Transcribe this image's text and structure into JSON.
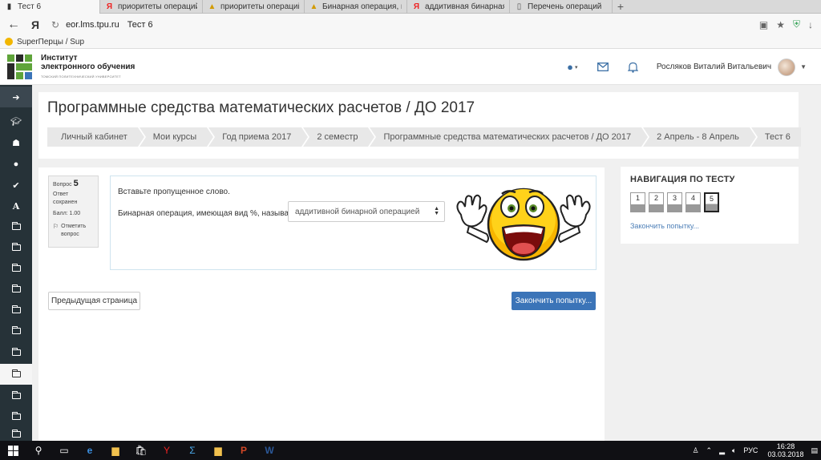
{
  "browser": {
    "tabs": [
      {
        "label": "Тест 6",
        "icon": "moodle-icon",
        "active": true
      },
      {
        "label": "приоритеты операций в вы",
        "icon": "yandex-icon",
        "active": false
      },
      {
        "label": "приоритеты операций в вы",
        "icon": "slides-icon",
        "active": false
      },
      {
        "label": "Бинарная операция, имею",
        "icon": "slides-icon",
        "active": false
      },
      {
        "label": "аддитивная бинарная опер",
        "icon": "yandex-icon",
        "active": false
      },
      {
        "label": "Перечень операций",
        "icon": "page-icon",
        "active": false
      }
    ],
    "url_domain": "eor.lms.tpu.ru",
    "url_title": "Тест 6",
    "bookmark": "SuperПерцы / Sup"
  },
  "header": {
    "logo_line1": "Институт",
    "logo_line2": "электронного обучения",
    "logo_line3": "ТОМСКИЙ ПОЛИТЕХНИЧЕСКИЙ УНИВЕРСИТЕТ",
    "user_name": "Росляков Виталий Витальевич"
  },
  "page": {
    "title": "Программные средства математических расчетов / ДО 2017",
    "breadcrumb": [
      "Личный кабинет",
      "Мои курсы",
      "Год приема 2017",
      "2 семестр",
      "Программные средства математических расчетов / ДО 2017",
      "2 Апрель - 8 Апрель",
      "Тест 6"
    ]
  },
  "question": {
    "label": "Вопрос",
    "number": "5",
    "status_line1": "Ответ",
    "status_line2": "сохранен",
    "grade": "Балл: 1.00",
    "flag_line1": "Отметить",
    "flag_line2": "вопрос",
    "instruction": "Вставьте пропущенное слово.",
    "prompt": "Бинарная операция, имеющая вид %, называется",
    "selected_answer": "аддитивной бинарной операцией"
  },
  "buttons": {
    "prev": "Предыдущая страница",
    "finish": "Закончить попытку..."
  },
  "navigation": {
    "title": "НАВИГАЦИЯ ПО ТЕСТУ",
    "items": [
      "1",
      "2",
      "3",
      "4",
      "5"
    ],
    "current": "5",
    "finish_link": "Закончить попытку..."
  },
  "taskbar": {
    "lang": "РУС",
    "time": "16:28",
    "date": "03.03.2018"
  }
}
